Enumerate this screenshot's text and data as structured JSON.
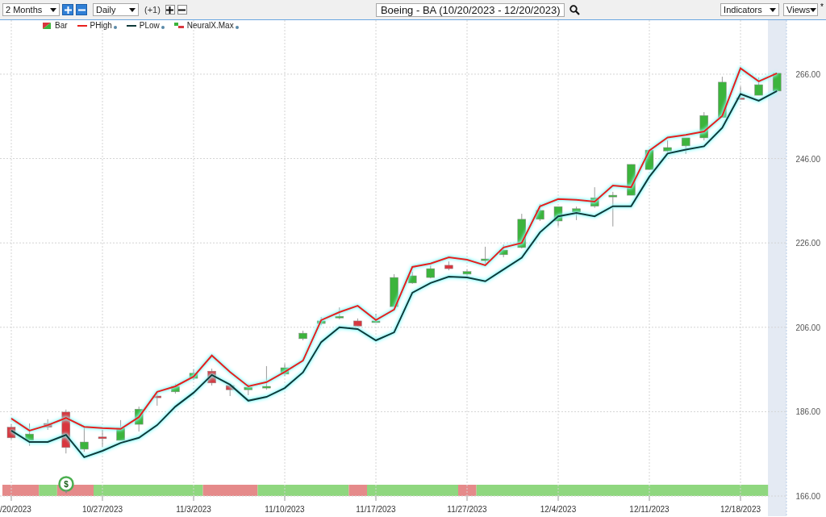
{
  "toolbar": {
    "period": "2 Months",
    "interval": "Daily",
    "offset": "(+1)",
    "title": "Boeing - BA (10/20/2023 - 12/20/2023)",
    "indicators": "Indicators",
    "views": "Views",
    "views_marker": "*"
  },
  "legend": [
    {
      "label": "Bar",
      "kind": "bar",
      "settings_dot": false
    },
    {
      "kind": "line",
      "settings_dot": true
    },
    {
      "kind": "line",
      "settings_dot": true
    },
    {
      "label": "NeuralX.Max",
      "kind": "signal",
      "settings_dot": true
    }
  ],
  "chart": {
    "chart_data": {
      "type": "candlestick",
      "grid": true,
      "categories": [
        "/20/2023",
        null,
        null,
        null,
        null,
        "10/27/2023",
        null,
        null,
        null,
        null,
        "11/3/2023",
        null,
        null,
        null,
        null,
        "11/10/2023",
        null,
        null,
        null,
        null,
        "11/17/2023",
        null,
        null,
        null,
        null,
        "11/27/2023",
        null,
        null,
        null,
        null,
        "12/4/2023",
        null,
        null,
        null,
        null,
        "12/11/2023",
        null,
        null,
        null,
        null,
        "12/18/2023",
        null,
        null
      ],
      "ohlc": [
        [
          182.3,
          183.0,
          179.4,
          179.8
        ],
        [
          179.2,
          183.2,
          177.9,
          180.7
        ],
        [
          183.2,
          184.2,
          181.7,
          182.3
        ],
        [
          185.9,
          186.5,
          176.1,
          177.5
        ],
        [
          177.1,
          182.4,
          176.5,
          178.8
        ],
        [
          180.0,
          181.7,
          177.7,
          179.6
        ],
        [
          179.2,
          184.0,
          179.2,
          182.1
        ],
        [
          183.0,
          187.2,
          181.3,
          186.6
        ],
        [
          189.7,
          190.7,
          187.4,
          189.3
        ],
        [
          190.7,
          192.6,
          190.3,
          192.0
        ],
        [
          193.9,
          196.0,
          193.5,
          195.1
        ],
        [
          195.6,
          196.2,
          192.2,
          192.8
        ],
        [
          192.2,
          192.2,
          189.7,
          191.2
        ],
        [
          191.2,
          192.6,
          189.9,
          191.8
        ],
        [
          191.6,
          196.8,
          191.2,
          192.0
        ],
        [
          194.9,
          197.4,
          194.5,
          196.4
        ],
        [
          203.3,
          205.2,
          202.9,
          204.6
        ],
        [
          206.9,
          208.4,
          206.5,
          207.5
        ],
        [
          208.3,
          210.7,
          207.9,
          208.6
        ],
        [
          207.5,
          208.1,
          206.2,
          206.3
        ],
        [
          207.3,
          209.2,
          207.3,
          207.5
        ],
        [
          210.9,
          218.6,
          210.9,
          217.8
        ],
        [
          216.5,
          219.2,
          216.3,
          218.2
        ],
        [
          217.8,
          220.7,
          217.6,
          219.9
        ],
        [
          220.7,
          221.6,
          219.5,
          219.9
        ],
        [
          218.6,
          219.7,
          218.2,
          219.2
        ],
        [
          221.8,
          225.1,
          221.1,
          222.2
        ],
        [
          223.2,
          225.6,
          222.6,
          224.3
        ],
        [
          224.9,
          232.9,
          224.7,
          231.6
        ],
        [
          231.6,
          235.2,
          231.2,
          233.7
        ],
        [
          231.2,
          234.6,
          229.9,
          234.6
        ],
        [
          233.3,
          234.6,
          231.4,
          234.1
        ],
        [
          234.7,
          239.2,
          234.3,
          236.7
        ],
        [
          236.9,
          238.1,
          229.9,
          237.3
        ],
        [
          237.3,
          244.6,
          237.3,
          244.6
        ],
        [
          243.4,
          248.0,
          243.4,
          248.0
        ],
        [
          247.8,
          250.3,
          247.6,
          248.6
        ],
        [
          249.0,
          250.9,
          247.1,
          250.9
        ],
        [
          250.9,
          257.0,
          250.3,
          256.2
        ],
        [
          255.7,
          265.4,
          255.7,
          264.1
        ],
        [
          260.4,
          263.1,
          260.0,
          260.3
        ],
        [
          261.0,
          265.2,
          261.0,
          263.5
        ],
        [
          262.0,
          266.2,
          262.0,
          266.2
        ]
      ],
      "series": [
        {
          "name": "PHigh",
          "type": "line",
          "color": "#e8201e",
          "values": [
            184.4,
            181.5,
            182.8,
            184.5,
            182.4,
            182.1,
            181.9,
            184.7,
            190.7,
            192.0,
            194.3,
            199.3,
            195.4,
            192.0,
            193.0,
            195.4,
            198.1,
            207.7,
            209.6,
            211.1,
            207.7,
            210.2,
            220.3,
            221.1,
            222.6,
            222.0,
            220.7,
            224.9,
            226.0,
            234.7,
            236.4,
            236.2,
            235.8,
            239.6,
            239.2,
            247.9,
            251.0,
            251.6,
            252.4,
            256.1,
            267.4,
            264.3,
            266.2
          ]
        },
        {
          "name": "PLow",
          "type": "line",
          "color": "#0f3a3a",
          "values": [
            181.5,
            178.8,
            178.8,
            180.5,
            175.2,
            176.7,
            178.6,
            179.8,
            182.8,
            187.2,
            190.5,
            194.7,
            192.4,
            188.6,
            189.5,
            191.6,
            195.3,
            202.5,
            206.0,
            205.6,
            202.9,
            204.8,
            214.2,
            216.5,
            218.0,
            217.8,
            216.9,
            219.7,
            222.5,
            228.5,
            232.3,
            233.1,
            232.3,
            234.7,
            234.7,
            241.7,
            247.2,
            248.1,
            248.9,
            253.3,
            261.3,
            259.7,
            262.0
          ]
        }
      ],
      "ylim": [
        166,
        278.8
      ],
      "yticks": [
        {
          "value": 166,
          "label": "166.00"
        },
        {
          "value": 186,
          "label": "186.00"
        },
        {
          "value": 206,
          "label": "206.00"
        },
        {
          "value": 226,
          "label": "226.00"
        },
        {
          "value": 246,
          "label": "246.00"
        },
        {
          "value": 266,
          "label": "266.00"
        }
      ]
    },
    "signals": [
      {
        "kind": "sell"
      },
      {
        "kind": "sell"
      },
      {
        "kind": "buy"
      },
      {
        "kind": "sell"
      },
      {
        "kind": "sell"
      },
      {
        "kind": "buy"
      },
      {
        "kind": "buy"
      },
      {
        "kind": "buy"
      },
      {
        "kind": "buy"
      },
      {
        "kind": "buy"
      },
      {
        "kind": "buy"
      },
      {
        "kind": "sell"
      },
      {
        "kind": "sell"
      },
      {
        "kind": "sell"
      },
      {
        "kind": "buy"
      },
      {
        "kind": "buy"
      },
      {
        "kind": "buy"
      },
      {
        "kind": "buy"
      },
      {
        "kind": "buy"
      },
      {
        "kind": "sell"
      },
      {
        "kind": "buy"
      },
      {
        "kind": "buy"
      },
      {
        "kind": "buy"
      },
      {
        "kind": "buy"
      },
      {
        "kind": "buy"
      },
      {
        "kind": "sell"
      },
      {
        "kind": "buy"
      },
      {
        "kind": "buy"
      },
      {
        "kind": "buy"
      },
      {
        "kind": "buy"
      },
      {
        "kind": "buy"
      },
      {
        "kind": "buy"
      },
      {
        "kind": "buy"
      },
      {
        "kind": "buy"
      },
      {
        "kind": "buy"
      },
      {
        "kind": "buy"
      },
      {
        "kind": "buy"
      },
      {
        "kind": "buy"
      },
      {
        "kind": "buy"
      },
      {
        "kind": "buy"
      },
      {
        "kind": "buy"
      },
      {
        "kind": "buy"
      }
    ],
    "signal_badge": "$"
  }
}
